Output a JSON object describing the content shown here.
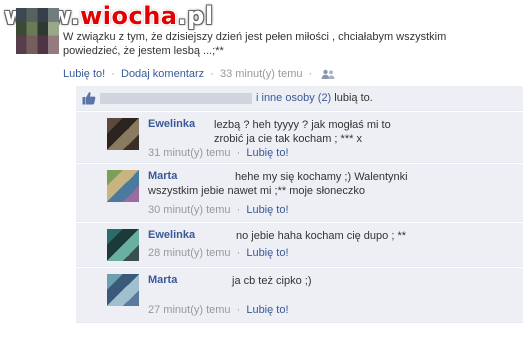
{
  "watermark": {
    "prefix": "www.",
    "brand": "wiocha",
    "suffix": ".pl"
  },
  "post": {
    "text": "W związku z tym, że dzisiejszy dzień jest pełen miłości , chciałabym wszystkim powiedzieć, że jestem lesbą ...;**",
    "like_label": "Lubię to!",
    "comment_label": "Dodaj komentarz",
    "time": "33 minut(y) temu",
    "sep": "·",
    "privacy_icon": "people-icon"
  },
  "likes": {
    "suffix": "i inne osoby",
    "count": "(2)",
    "tail": "lubią to.",
    "icon": "thumbs-up-icon"
  },
  "comments": [
    {
      "name": "Ewelinka",
      "text": "lezbą ? heh tyyyy ? jak mogłaś mi to zrobić ja cie tak kocham ; *** x",
      "time": "31 minut(y) temu",
      "like": "Lubię to!"
    },
    {
      "name": "Marta",
      "text": "hehe my się kochamy ;) Walentynki wszystkim jebie nawet mi ;** moje słoneczko",
      "time": "30 minut(y) temu",
      "like": "Lubię to!"
    },
    {
      "name": "Ewelinka",
      "text": "no jebie haha kocham cię dupo ; **",
      "time": "28 minut(y) temu",
      "like": "Lubię to!"
    },
    {
      "name": "Marta",
      "text": "ja cb też cipko ;)",
      "time": "27 minut(y) temu",
      "like": "Lubię to!"
    }
  ],
  "colors": {
    "link": "#3b5998",
    "comment_bg": "#edeff4",
    "muted": "#999999",
    "watermark_red": "#e30000"
  }
}
